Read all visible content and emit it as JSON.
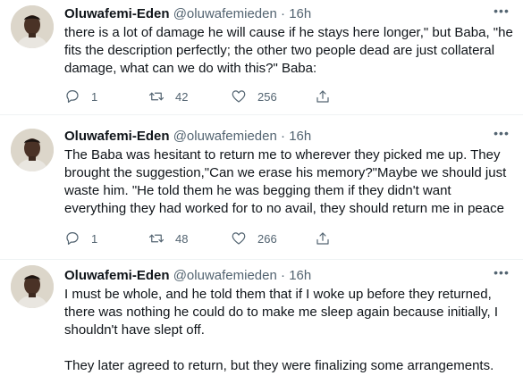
{
  "tweets": [
    {
      "name": "Oluwafemi-Eden",
      "handle": "@oluwafemieden",
      "dot": "·",
      "time": "16h",
      "text": "there is a lot of damage he will cause if he stays here longer,\" but Baba, \"he fits the description perfectly; the other two people dead are just collateral damage, what can we do with this?\" Baba:",
      "replies": "1",
      "retweets": "42",
      "likes": "256"
    },
    {
      "name": "Oluwafemi-Eden",
      "handle": "@oluwafemieden",
      "dot": "·",
      "time": "16h",
      "text": "The Baba was hesitant to return me to wherever they picked me up. They brought the suggestion,\"Can we erase his memory?\"Maybe we should just waste him. \"He told them he was begging them if they didn't want everything they had worked for to no avail, they should return me in peace",
      "replies": "1",
      "retweets": "48",
      "likes": "266"
    },
    {
      "name": "Oluwafemi-Eden",
      "handle": "@oluwafemieden",
      "dot": "·",
      "time": "16h",
      "text": "I must be whole, and he told them that if I woke up before they returned, there was nothing he could do to make me sleep again because initially, I shouldn't have slept off.\n\nThey later agreed to return, but they were finalizing some arrangements."
    }
  ],
  "icons": {
    "more": "more-icon",
    "reply": "reply-icon",
    "retweet": "retweet-icon",
    "like": "heart-icon",
    "share": "share-icon"
  },
  "colors": {
    "text": "#0f1419",
    "secondary": "#536471",
    "divider": "#eff3f4"
  }
}
